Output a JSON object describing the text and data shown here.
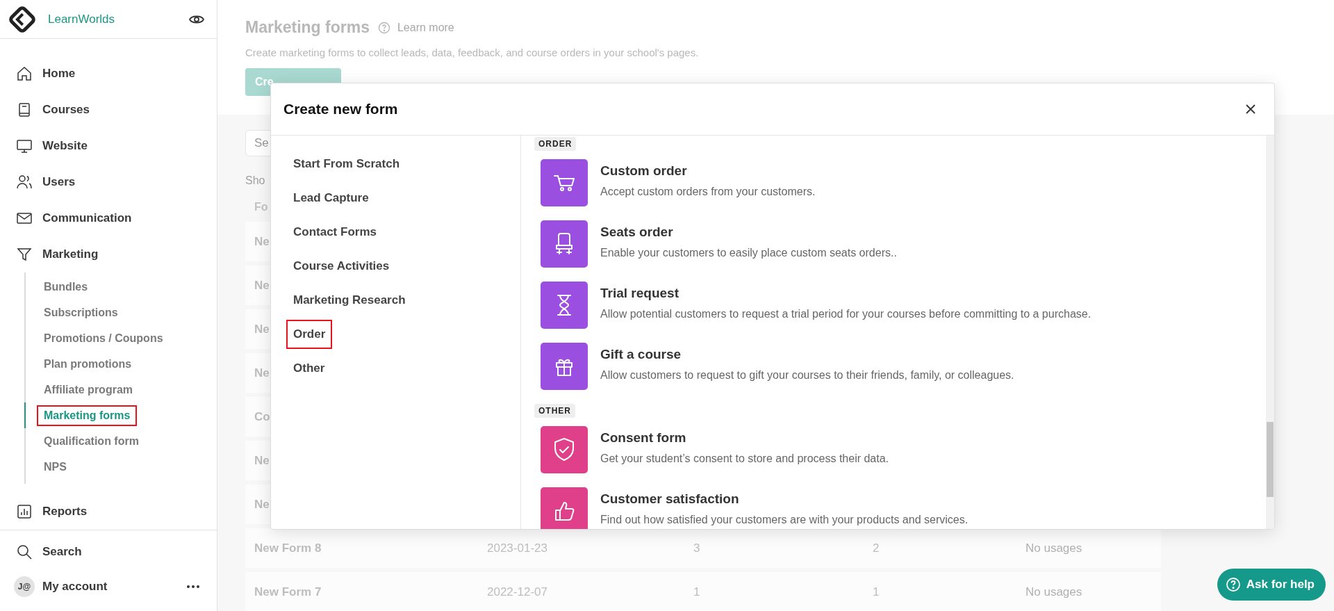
{
  "sidebar": {
    "brand": "LearnWorlds",
    "items": [
      {
        "label": "Home",
        "kind": "home"
      },
      {
        "label": "Courses",
        "kind": "book"
      },
      {
        "label": "Website",
        "kind": "monitor"
      },
      {
        "label": "Users",
        "kind": "users"
      },
      {
        "label": "Communication",
        "kind": "mail"
      },
      {
        "label": "Marketing",
        "kind": "funnel",
        "expanded": true,
        "children": [
          {
            "label": "Bundles",
            "selected": false,
            "highlighted": false
          },
          {
            "label": "Subscriptions",
            "selected": false,
            "highlighted": false
          },
          {
            "label": "Promotions / Coupons",
            "selected": false,
            "highlighted": false
          },
          {
            "label": "Plan promotions",
            "selected": false,
            "highlighted": false
          },
          {
            "label": "Affiliate program",
            "selected": false,
            "highlighted": false
          },
          {
            "label": "Marketing forms",
            "selected": true,
            "highlighted": true
          },
          {
            "label": "Qualification form",
            "selected": false,
            "highlighted": false
          },
          {
            "label": "NPS",
            "selected": false,
            "highlighted": false
          }
        ]
      },
      {
        "label": "Reports",
        "kind": "chart"
      }
    ],
    "footer": [
      {
        "label": "Search",
        "kind": "search"
      },
      {
        "label": "My account",
        "kind": "avatar",
        "avatar_text": "J@"
      }
    ]
  },
  "page": {
    "title": "Marketing forms",
    "learn_more": "Learn more",
    "subtitle": "Create marketing forms to collect leads, data, feedback, and course orders in your school's pages.",
    "create_button": "Cre",
    "search": {
      "placeholder": "Se"
    },
    "showing": "Sho",
    "column_header": "Fo",
    "covered_rows": [
      "Ne",
      "Ne",
      "Ne",
      "Ne",
      "Co",
      "Ne",
      "Ne"
    ],
    "rows": [
      [
        "New Form 8",
        "2023-01-23",
        "3",
        "2",
        "No usages"
      ],
      [
        "New Form 7",
        "2022-12-07",
        "1",
        "1",
        "No usages"
      ]
    ]
  },
  "modal": {
    "title": "Create new form",
    "categories": [
      {
        "label": "Start From Scratch",
        "highlighted": false
      },
      {
        "label": "Lead Capture",
        "highlighted": false
      },
      {
        "label": "Contact Forms",
        "highlighted": false
      },
      {
        "label": "Course Activities",
        "highlighted": false
      },
      {
        "label": "Marketing Research",
        "highlighted": false
      },
      {
        "label": "Order",
        "highlighted": true
      },
      {
        "label": "Other",
        "highlighted": false
      }
    ],
    "sections": [
      {
        "label": "ORDER",
        "items": [
          {
            "title": "Custom order",
            "description": "Accept custom orders from your customers.",
            "kind": "cart",
            "color": "#9b4fe0"
          },
          {
            "title": "Seats order",
            "description": "Enable your customers to easily place custom seats orders..",
            "kind": "seat",
            "color": "#9b4fe0"
          },
          {
            "title": "Trial request",
            "description": "Allow potential customers to request a trial period for your courses before committing to a purchase.",
            "kind": "hourglass",
            "color": "#9b4fe0"
          },
          {
            "title": "Gift a course",
            "description": "Allow customers to request to gift your courses to their friends, family, or colleagues.",
            "kind": "gift",
            "color": "#9b4fe0"
          }
        ]
      },
      {
        "label": "OTHER",
        "items": [
          {
            "title": "Consent form",
            "description": "Get your student’s consent to store and process their data.",
            "kind": "shield",
            "color": "#e03f8a"
          },
          {
            "title": "Customer satisfaction",
            "description": "Find out how satisfied your customers are with your products and services.",
            "kind": "thumb",
            "color": "#e03f8a"
          }
        ]
      }
    ]
  },
  "help_button": "Ask for help"
}
